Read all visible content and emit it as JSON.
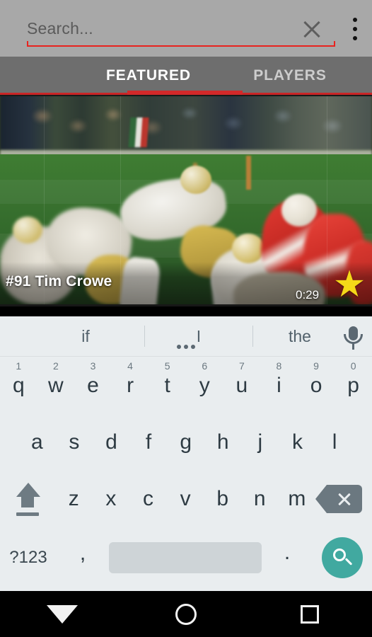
{
  "search": {
    "placeholder": "Search...",
    "value": "",
    "clear_icon": "close-icon",
    "overflow_icon": "more-vertical-icon",
    "underline_color": "#e8231f"
  },
  "tabs": {
    "items": [
      {
        "label": "FEATURED",
        "active": true
      },
      {
        "label": "PLAYERS",
        "active": false
      }
    ],
    "indicator_color": "#d3292a",
    "bar_color": "#6e6e6e"
  },
  "video_card": {
    "title": "#91 Tim Crowe",
    "duration": "0:29",
    "star_icon": "star-icon",
    "star_color": "#f5d818",
    "favorited": true
  },
  "keyboard": {
    "suggestions": [
      "if",
      "I",
      "the"
    ],
    "expand_icon": "more-dots-icon",
    "mic_icon": "microphone-icon",
    "rows": [
      {
        "keys": [
          {
            "label": "q",
            "num": "1"
          },
          {
            "label": "w",
            "num": "2"
          },
          {
            "label": "e",
            "num": "3"
          },
          {
            "label": "r",
            "num": "4"
          },
          {
            "label": "t",
            "num": "5"
          },
          {
            "label": "y",
            "num": "6"
          },
          {
            "label": "u",
            "num": "7"
          },
          {
            "label": "i",
            "num": "8"
          },
          {
            "label": "o",
            "num": "9"
          },
          {
            "label": "p",
            "num": "0"
          }
        ]
      },
      {
        "keys": [
          {
            "label": "a"
          },
          {
            "label": "s"
          },
          {
            "label": "d"
          },
          {
            "label": "f"
          },
          {
            "label": "g"
          },
          {
            "label": "h"
          },
          {
            "label": "j"
          },
          {
            "label": "k"
          },
          {
            "label": "l"
          }
        ]
      },
      {
        "keys": [
          {
            "label": "z"
          },
          {
            "label": "x"
          },
          {
            "label": "c"
          },
          {
            "label": "v"
          },
          {
            "label": "b"
          },
          {
            "label": "n"
          },
          {
            "label": "m"
          }
        ]
      }
    ],
    "shift_icon": "shift-icon",
    "backspace_icon": "backspace-icon",
    "symbols_label": "?123",
    "comma_label": ",",
    "period_label": ".",
    "space_label": "",
    "search_icon": "search-icon",
    "search_key_color": "#41a9a0",
    "background_color": "#e9edef"
  },
  "navbar": {
    "back_icon": "hide-keyboard-icon",
    "home_icon": "home-circle-icon",
    "recents_icon": "recents-square-icon"
  }
}
